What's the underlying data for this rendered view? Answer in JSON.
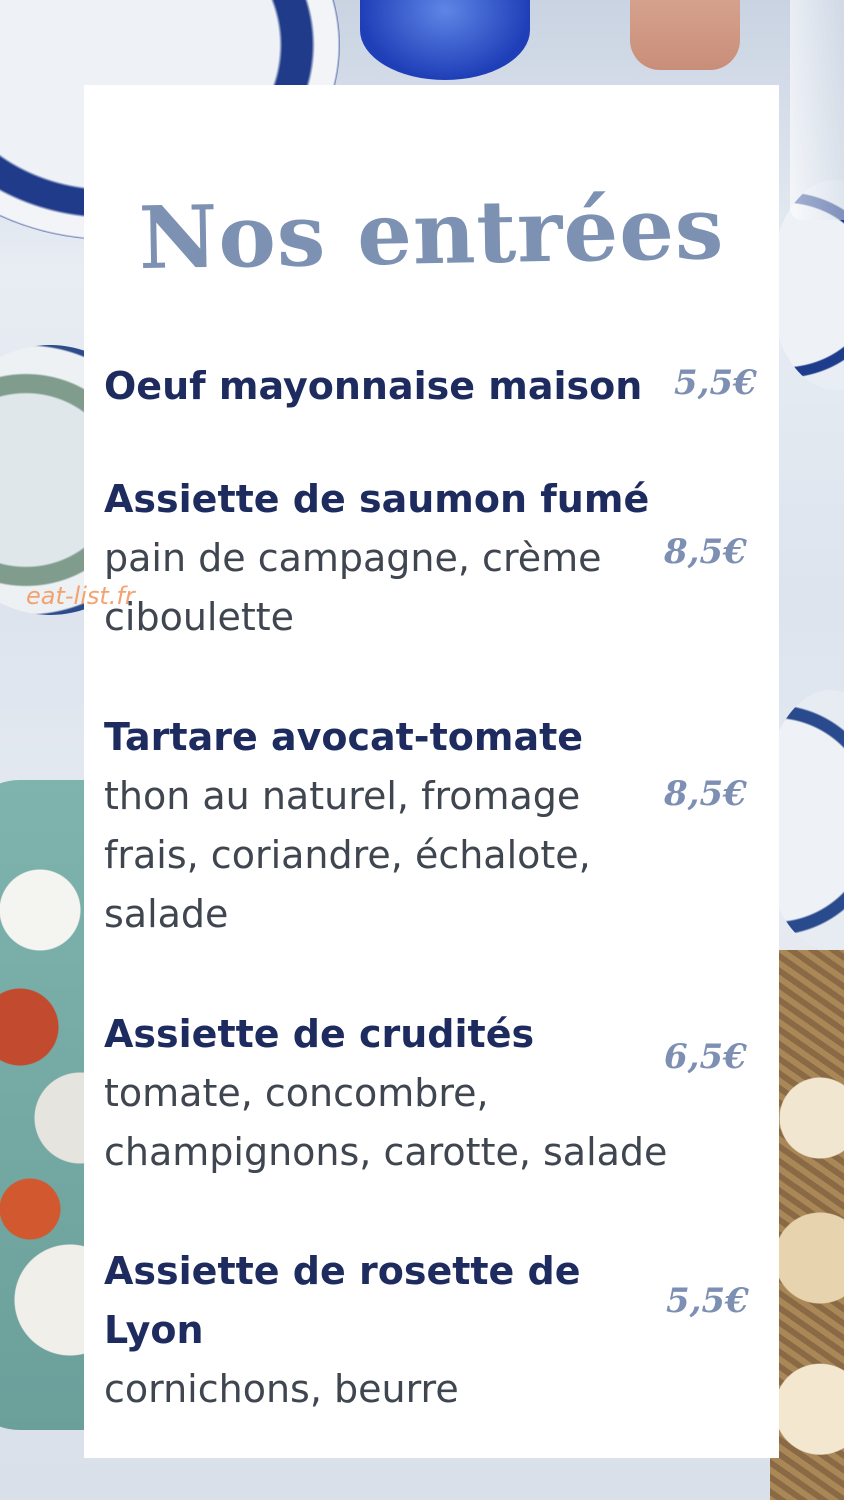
{
  "title": "Nos entrées",
  "items": [
    {
      "name": "Oeuf mayonnaise maison",
      "description": "",
      "price": "5,5€"
    },
    {
      "name": "Assiette de saumon fumé",
      "description": "pain de campagne, crème ciboulette",
      "price": "8,5€"
    },
    {
      "name": "Tartare avocat-tomate",
      "description": "thon au naturel, fromage frais, coriandre, échalote, salade",
      "price": "8,5€"
    },
    {
      "name": "Assiette de crudités",
      "description": "tomate, concombre, champignons, carotte, salade",
      "price": "6,5€"
    },
    {
      "name": "Assiette de rosette de Lyon",
      "description": "cornichons, beurre",
      "price": "5,5€"
    }
  ],
  "watermark": "eat-list.fr",
  "colors": {
    "title": "#7d91b3",
    "item_name": "#1d2b5e",
    "price": "#7d8fb2",
    "watermark": "#f29a62"
  }
}
